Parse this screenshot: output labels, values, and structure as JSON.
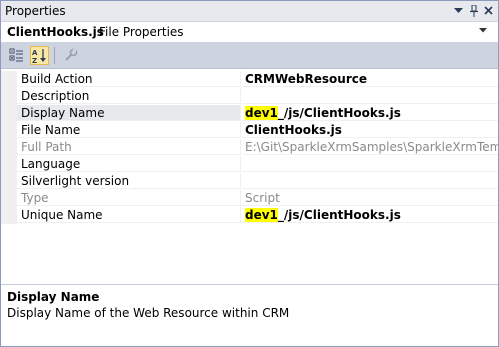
{
  "window": {
    "title": "Properties",
    "dropdown_glyph": "▼",
    "pin_glyph": "📌",
    "close_glyph": "×"
  },
  "object_selector": {
    "name": "ClientHooks.js",
    "type": "File Properties",
    "arrow": "▼"
  },
  "toolbar": {
    "icons": [
      "categorized-icon",
      "alphabetical-icon",
      "property-pages-icon"
    ],
    "active": "alphabetical"
  },
  "properties": [
    {
      "name": "Build Action",
      "value": "CRMWebResource",
      "bold": true,
      "disabled": false,
      "highlight": ""
    },
    {
      "name": "Description",
      "value": "",
      "bold": false,
      "disabled": false,
      "highlight": ""
    },
    {
      "name": "Display Name",
      "value_hl": "dev1",
      "value_rest": "_/js/ClientHooks.js",
      "bold": true,
      "disabled": false
    },
    {
      "name": "File Name",
      "value": "ClientHooks.js",
      "bold": true,
      "disabled": false,
      "highlight": ""
    },
    {
      "name": "Full Path",
      "value": "E:\\Git\\SparkleXrmSamples\\SparkleXrmTemplate\\Spar",
      "bold": false,
      "disabled": true,
      "highlight": ""
    },
    {
      "name": "Language",
      "value": "",
      "bold": false,
      "disabled": false,
      "highlight": ""
    },
    {
      "name": "Silverlight version",
      "value": "",
      "bold": false,
      "disabled": false,
      "highlight": ""
    },
    {
      "name": "Type",
      "value": "Script",
      "bold": false,
      "disabled": true,
      "highlight": ""
    },
    {
      "name": "Unique Name",
      "value_hl": "dev1",
      "value_rest": "_/js/ClientHooks.js",
      "bold": true,
      "disabled": false
    }
  ],
  "selected_property": "Display Name",
  "description": {
    "title": "Display Name",
    "text": "Display Name of the Web Resource within CRM"
  },
  "colors": {
    "highlight": "#ffff00",
    "toolbar": "#cdd3df",
    "active_tool": "#f9e8a3"
  }
}
